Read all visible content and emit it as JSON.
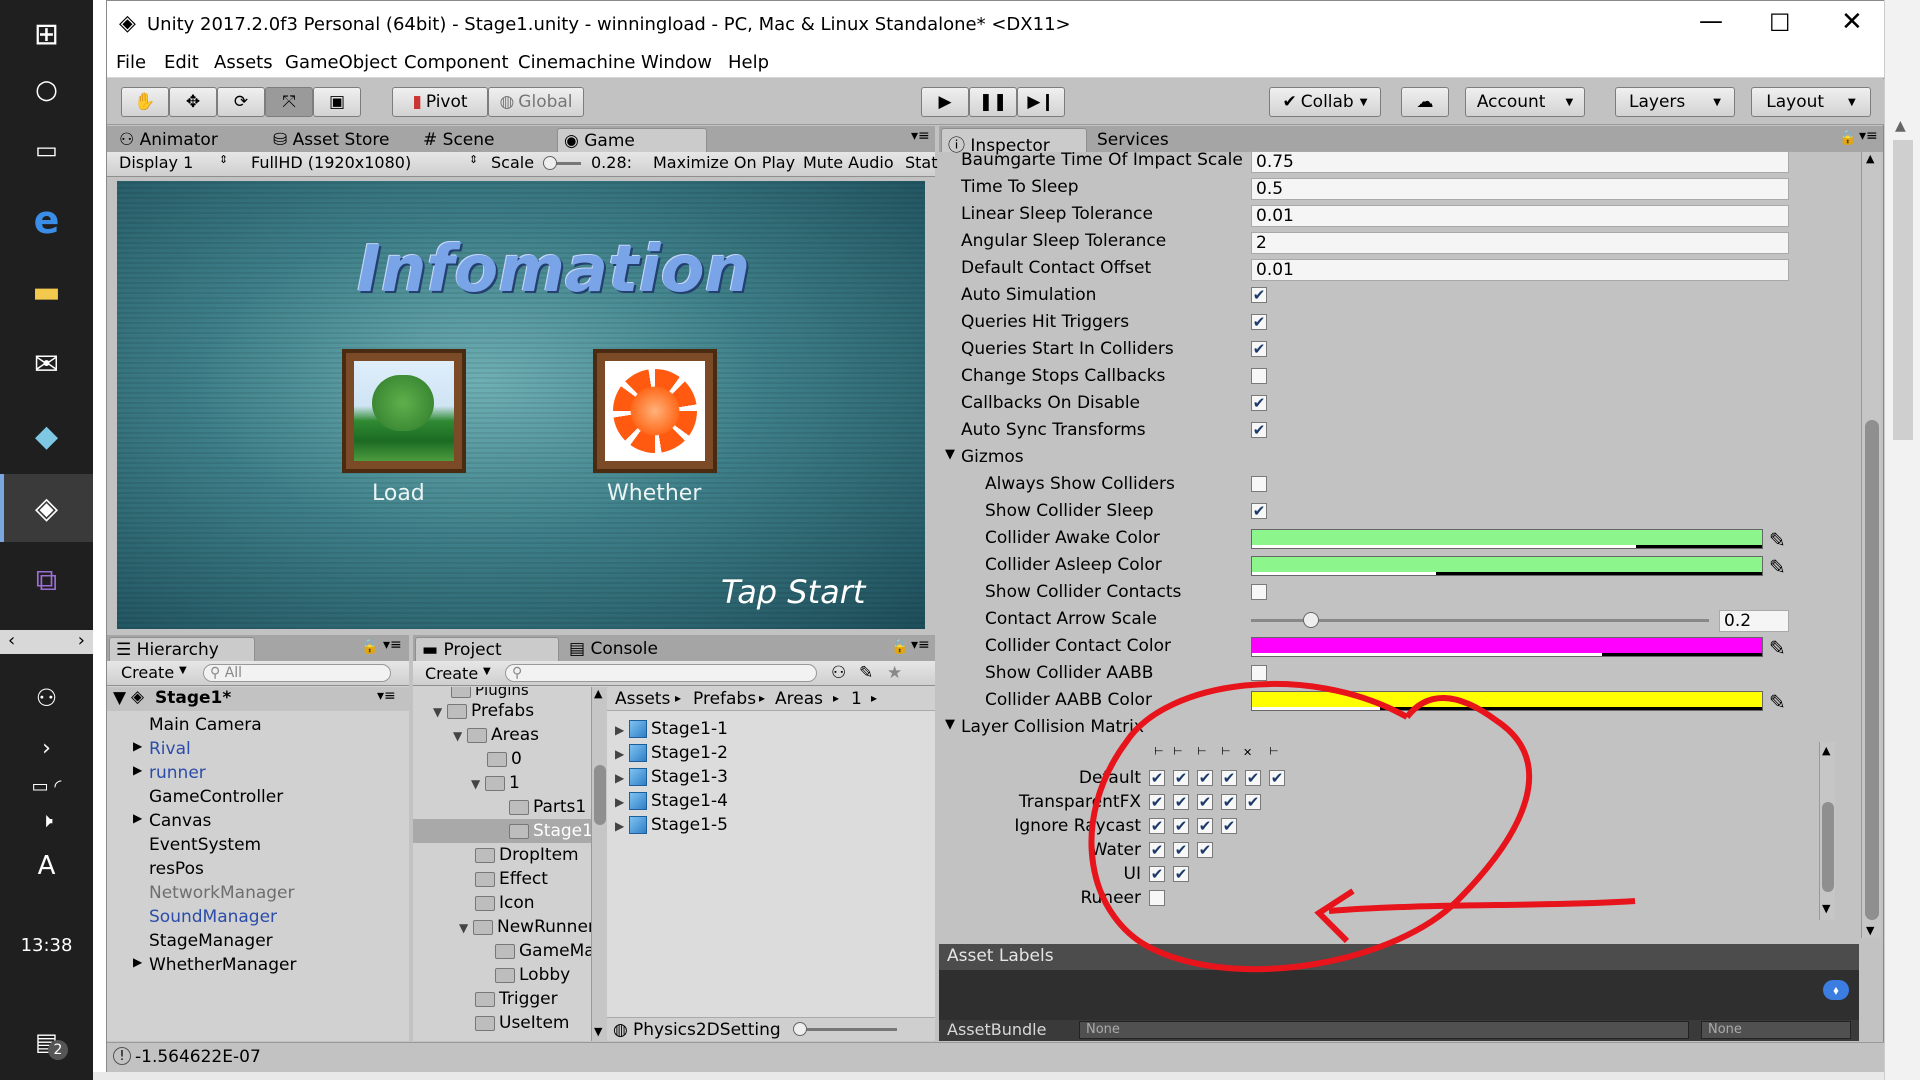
{
  "taskbar": {
    "clock": "13:38",
    "notification_count": "2"
  },
  "window": {
    "title": "Unity 2017.2.0f3 Personal (64bit) - Stage1.unity - winningload - PC, Mac & Linux Standalone* <DX11>"
  },
  "menu": [
    "File",
    "Edit",
    "Assets",
    "GameObject",
    "Component",
    "Cinemachine",
    "Window",
    "Help"
  ],
  "toolbar": {
    "pivot": "Pivot",
    "global": "Global",
    "collab": "Collab",
    "account": "Account",
    "layers": "Layers",
    "layout": "Layout"
  },
  "tabs_left": {
    "animator": "Animator",
    "asset_store": "Asset Store",
    "scene": "Scene",
    "game": "Game"
  },
  "game_bar": {
    "display": "Display 1",
    "resolution": "FullHD (1920x1080)",
    "scale_label": "Scale",
    "scale_value": "0.28:",
    "maximize": "Maximize On Play",
    "mute": "Mute Audio",
    "stats": "Stat"
  },
  "game_view": {
    "title": "Infomation",
    "load": "Load",
    "whether": "Whether",
    "tap": "Tap Start"
  },
  "hierarchy": {
    "tab": "Hierarchy",
    "create": "Create",
    "search_placeholder": "All",
    "scene": "Stage1*",
    "items": [
      "Main Camera",
      "Rival",
      "runner",
      "GameController",
      "Canvas",
      "EventSystem",
      "resPos",
      "NetworkManager",
      "SoundManager",
      "StageManager",
      "WhetherManager"
    ]
  },
  "project": {
    "tab": "Project",
    "console_tab": "Console",
    "create": "Create",
    "tree": [
      "Plugins",
      "Prefabs",
      "Areas",
      "0",
      "1",
      "Parts1",
      "Stage1",
      "DropItem",
      "Effect",
      "Icon",
      "NewRunner",
      "GameMain",
      "Lobby",
      "Trigger",
      "UseItem"
    ],
    "breadcrumb": [
      "Assets",
      "Prefabs",
      "Areas",
      "1"
    ],
    "assets": [
      "Stage1-1",
      "Stage1-2",
      "Stage1-3",
      "Stage1-4",
      "Stage1-5"
    ],
    "footer": "Physics2DSetting"
  },
  "inspector": {
    "tab": "Inspector",
    "services_tab": "Services",
    "rows": [
      {
        "label": "Baumgarte Time Of Impact Scale",
        "value": "0.75"
      },
      {
        "label": "Time To Sleep",
        "value": "0.5"
      },
      {
        "label": "Linear Sleep Tolerance",
        "value": "0.01"
      },
      {
        "label": "Angular Sleep Tolerance",
        "value": "2"
      },
      {
        "label": "Default Contact Offset",
        "value": "0.01"
      }
    ],
    "checks": [
      {
        "label": "Auto Simulation",
        "on": true
      },
      {
        "label": "Queries Hit Triggers",
        "on": true
      },
      {
        "label": "Queries Start In Colliders",
        "on": true
      },
      {
        "label": "Change Stops Callbacks",
        "on": false
      },
      {
        "label": "Callbacks On Disable",
        "on": true
      },
      {
        "label": "Auto Sync Transforms",
        "on": true
      }
    ],
    "gizmos": "Gizmos",
    "always_show": "Always Show Colliders",
    "show_sleep": "Show Collider Sleep",
    "awake_color": "Collider Awake Color",
    "asleep_color": "Collider Asleep Color",
    "show_contacts": "Show Collider Contacts",
    "arrow_scale": "Contact Arrow Scale",
    "arrow_scale_value": "0.2",
    "contact_color": "Collider Contact Color",
    "show_aabb": "Show Collider AABB",
    "aabb_color": "Collider AABB Color",
    "matrix_title": "Layer Collision Matrix",
    "matrix_rows": [
      "Default",
      "TransparentFX",
      "Ignore Raycast",
      "Water",
      "UI",
      "Runeer"
    ],
    "asset_labels": "Asset Labels",
    "asset_bundle": "AssetBundle",
    "none1": "None",
    "none2": "None"
  },
  "status": {
    "text": "-1.564622E-07"
  },
  "colors": {
    "awake": "#8cf58c",
    "asleep": "#8cf58c",
    "contact": "#ff00ff",
    "aabb": "#ffff00",
    "annotation": "#e8141b"
  }
}
